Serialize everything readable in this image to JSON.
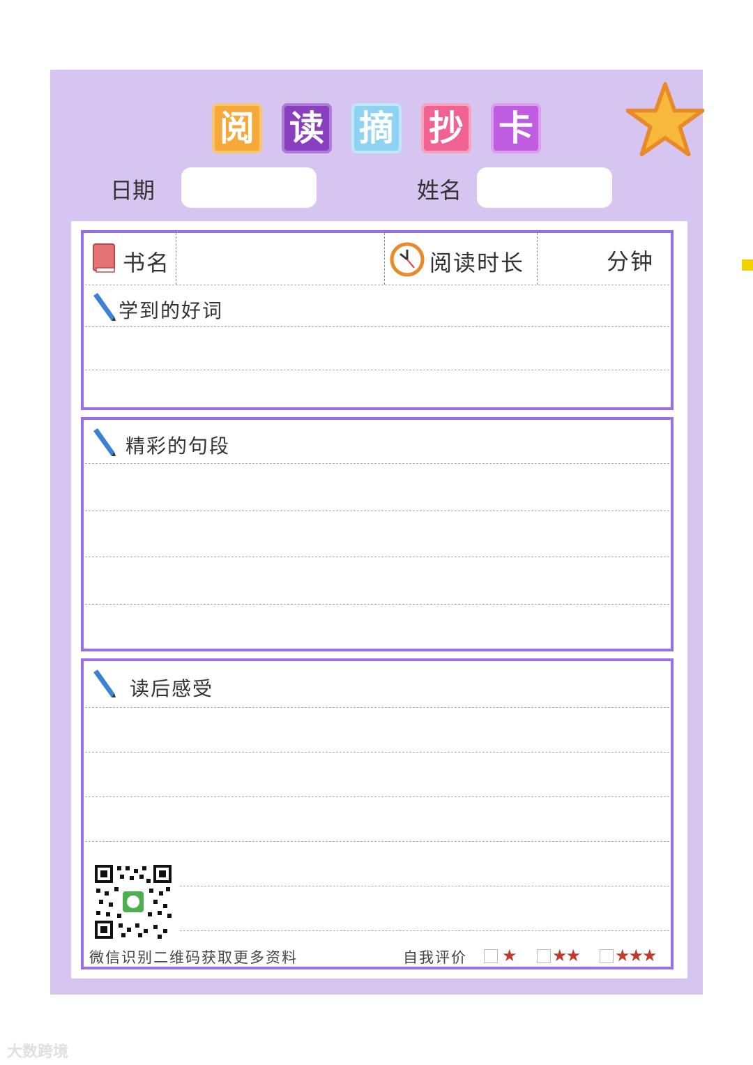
{
  "title_chars": [
    "阅",
    "读",
    "摘",
    "抄",
    "卡"
  ],
  "title_colors": [
    "#f6a93b",
    "#8a3fbf",
    "#8fd3f4",
    "#f06292",
    "#c05ce0"
  ],
  "date_label": "日期",
  "name_label": "姓名",
  "book_label": "书名",
  "reading_time_label": "阅读时长",
  "minutes_label": "分钟",
  "sections": {
    "good_words": "学到的好词",
    "wonderful_passages": "精彩的句段",
    "reflection": "读后感受"
  },
  "footer": {
    "qr_hint": "微信识别二维码获取更多资料",
    "self_eval_label": "自我评价",
    "ratings": [
      "★",
      "★★",
      "★★★"
    ]
  },
  "watermark": "大数跨境",
  "colors": {
    "card_bg": "#d6c5f0",
    "border": "#9a6ee6",
    "star": "#f6b93b"
  },
  "icons": [
    "star-icon",
    "book-icon",
    "clock-icon",
    "pencil-icon",
    "qr-code-icon",
    "checkbox-icon"
  ]
}
